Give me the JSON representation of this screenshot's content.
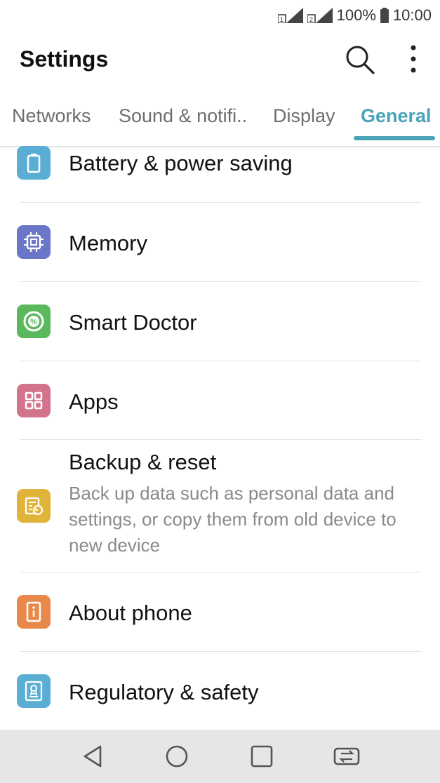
{
  "status": {
    "battery_percent": "100%",
    "time": "10:00",
    "sim1": "1",
    "sim2": "2"
  },
  "appbar": {
    "title": "Settings"
  },
  "tabs": [
    {
      "label": "Networks"
    },
    {
      "label": "Sound & notifi.."
    },
    {
      "label": "Display"
    },
    {
      "label": "General"
    }
  ],
  "items": [
    {
      "label": "Battery & power saving",
      "icon": "battery-icon",
      "color": "#5aaed4"
    },
    {
      "label": "Memory",
      "icon": "chip-icon",
      "color": "#6b76c9"
    },
    {
      "label": "Smart Doctor",
      "icon": "smart-doctor-icon",
      "color": "#5cb85c"
    },
    {
      "label": "Apps",
      "icon": "apps-grid-icon",
      "color": "#d2738c"
    },
    {
      "label": "Backup & reset",
      "subtitle": "Back up data such as personal data and settings, or copy them from old device to new device",
      "icon": "backup-icon",
      "color": "#e0b43a"
    },
    {
      "label": "About phone",
      "icon": "info-icon",
      "color": "#e8894a"
    },
    {
      "label": "Regulatory & safety",
      "icon": "certificate-icon",
      "color": "#5aaed4"
    }
  ],
  "colors": {
    "accent": "#4aa3b8",
    "navbar": "#e6e6e6"
  }
}
